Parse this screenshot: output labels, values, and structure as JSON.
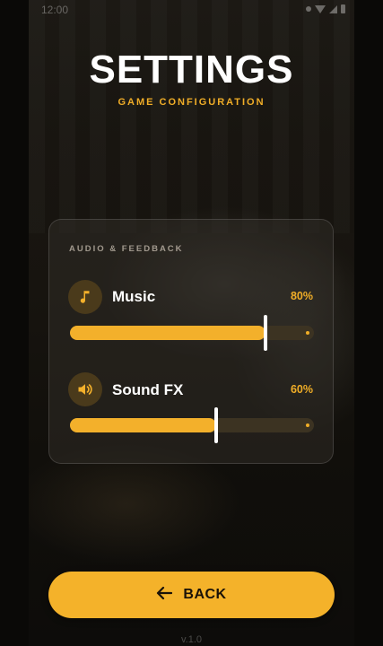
{
  "status_bar": {
    "time": "12:00"
  },
  "header": {
    "title": "SETTINGS",
    "subtitle": "GAME CONFIGURATION"
  },
  "audio": {
    "section_label": "AUDIO & FEEDBACK",
    "music": {
      "label": "Music",
      "value_text": "80%",
      "value": 0.8,
      "icon": "music-note-icon"
    },
    "sound_fx": {
      "label": "Sound FX",
      "value_text": "60%",
      "value": 0.6,
      "icon": "speaker-icon"
    }
  },
  "footer": {
    "back_label": "BACK",
    "back_icon": "arrow-left-icon",
    "version": "v.1.0"
  },
  "colors": {
    "accent": "#f3b02b",
    "track": "#3c3322",
    "icon_bg": "#4a3a1b",
    "background": "#17140f"
  }
}
